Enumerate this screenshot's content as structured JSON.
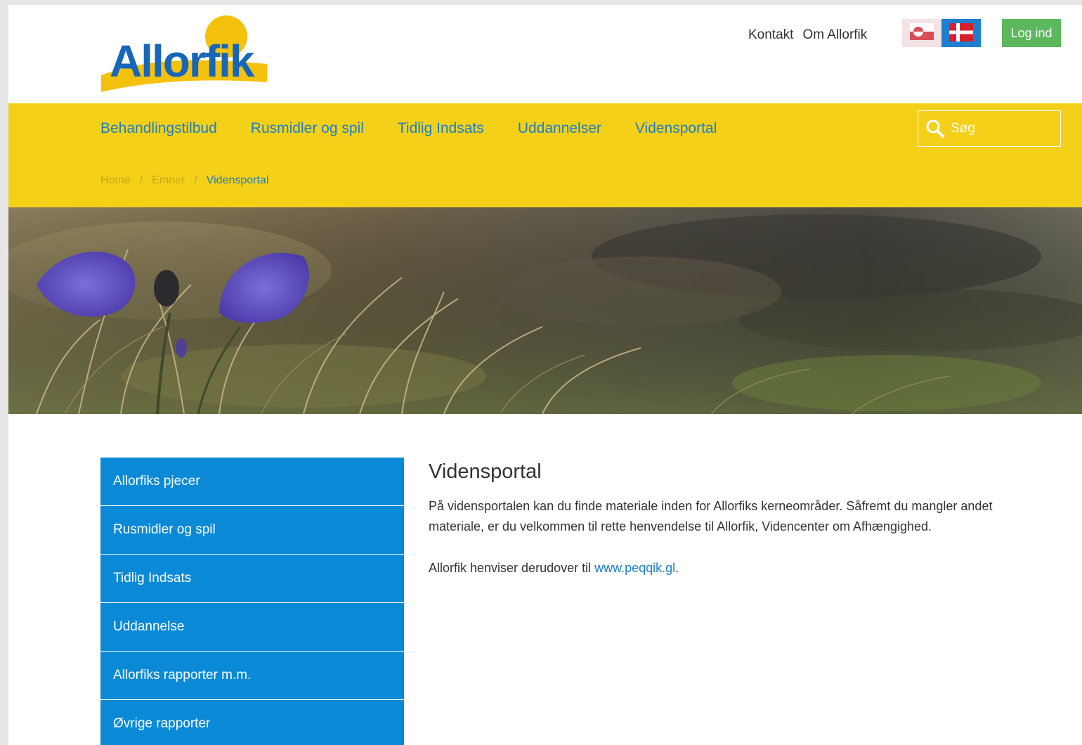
{
  "header": {
    "logo_text": "Allorfik",
    "top_links": [
      "Kontakt",
      "Om Allorfik"
    ],
    "login_label": "Log ind"
  },
  "nav": {
    "items": [
      "Behandlingstilbud",
      "Rusmidler og spil",
      "Tidlig Indsats",
      "Uddannelser",
      "Vidensportal"
    ],
    "search_placeholder": "Søg"
  },
  "breadcrumb": {
    "items": [
      "Home",
      "Emner",
      "Vidensportal"
    ],
    "separator": "/"
  },
  "sidebar": {
    "items": [
      "Allorfiks pjecer",
      "Rusmidler og spil",
      "Tidlig Indsats",
      "Uddannelse",
      "Allorfiks rapporter m.m.",
      "Øvrige rapporter"
    ]
  },
  "content": {
    "title": "Vidensportal",
    "paragraph1": "På vidensportalen kan du finde materiale inden for Allorfiks kerneområder. Såfremt du mangler andet materiale, er du velkommen til rette henvendelse til Allorfik, Videncenter om Afhængighed.",
    "paragraph2_prefix": "Allorfik henviser derudover til ",
    "paragraph2_link": "www.peqqik.gl",
    "paragraph2_suffix": "."
  },
  "colors": {
    "brand_yellow": "#f4d019",
    "brand_blue": "#1d7fc5",
    "sidebar_blue": "#0a8ad6",
    "login_green": "#5cb85c"
  },
  "icons": {
    "search": "search-icon",
    "flag_greenland": "flag-greenland-icon",
    "flag_denmark": "flag-denmark-icon"
  }
}
